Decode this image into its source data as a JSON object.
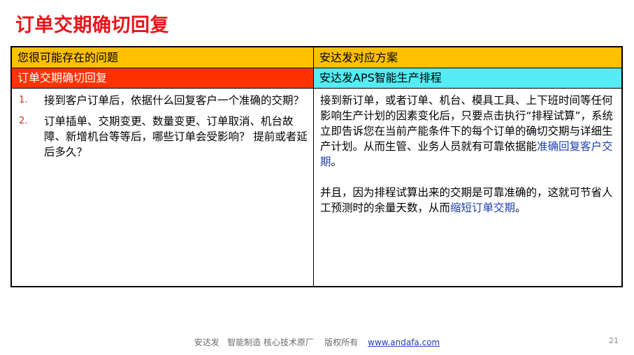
{
  "title": "订单交期确切回复",
  "table": {
    "left_header": "您很可能存在的问题",
    "right_header": "安达发对应方案",
    "left_subheader": "订单交期确切回复",
    "right_subheader": "安达发APS智能生产排程",
    "questions": [
      {
        "num": "1.",
        "text": "接到客户订单后，依据什么回复客户一个准确的交期？"
      },
      {
        "num": "2.",
        "text": "订单插单、交期变更、数量变更、订单取消、机台故障、新增机台等等后，哪些订单会受影响？ 提前或者延后多久？"
      }
    ],
    "answer_p1": "接到新订单，或者订单、机台、模具工具、上下班时间等任何影响生产计划的因素变化后，只要点击执行“排程试算”，系统立即告诉您在当前产能条件下的每个订单的确切交期与详细生产计划。从而生管、业务人员就有可靠依据能",
    "answer_p1_highlight": "准确回复客户交期",
    "answer_p1_end": "。",
    "answer_p2": "并且，因为排程试算出来的交期是可靠准确的，这就可节省人工预测时的余量天数，从而",
    "answer_p2_highlight": "缩短订单交期",
    "answer_p2_end": "。"
  },
  "footer": {
    "text": "安达发   智能制造 核心技术原厂    版权所有",
    "link": "www.andafa.com",
    "page_number": "21"
  },
  "colors": {
    "title": "#e8141c",
    "header_bg": "#ffc000",
    "left_sub_bg": "#ff3300",
    "right_sub_bg": "#55ecf5",
    "highlight_text": "#1f3fb0"
  }
}
